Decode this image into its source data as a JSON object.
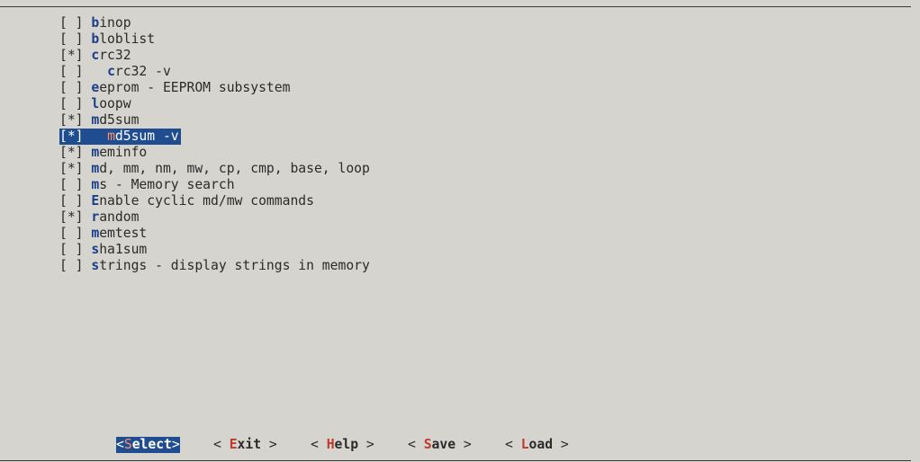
{
  "menu": {
    "items": [
      {
        "checkbox": "[ ]",
        "indent": " ",
        "hotkey": "b",
        "rest": "inop",
        "selected": false
      },
      {
        "checkbox": "[ ]",
        "indent": " ",
        "hotkey": "b",
        "rest": "loblist",
        "selected": false
      },
      {
        "checkbox": "[*]",
        "indent": " ",
        "hotkey": "c",
        "rest": "rc32",
        "selected": false
      },
      {
        "checkbox": "[ ]",
        "indent": "   ",
        "hotkey": "c",
        "rest": "rc32 -v",
        "selected": false
      },
      {
        "checkbox": "[ ]",
        "indent": " ",
        "hotkey": "e",
        "rest": "eprom - EEPROM subsystem",
        "selected": false
      },
      {
        "checkbox": "[ ]",
        "indent": " ",
        "hotkey": "l",
        "rest": "oopw",
        "selected": false
      },
      {
        "checkbox": "[*]",
        "indent": " ",
        "hotkey": "m",
        "rest": "d5sum",
        "selected": false
      },
      {
        "checkbox": "[*]",
        "indent": "   ",
        "hotkey": "m",
        "rest": "d5sum -v",
        "selected": true
      },
      {
        "checkbox": "[*]",
        "indent": " ",
        "hotkey": "m",
        "rest": "eminfo",
        "selected": false
      },
      {
        "checkbox": "[*]",
        "indent": " ",
        "hotkey": "m",
        "rest": "d, mm, nm, mw, cp, cmp, base, loop",
        "selected": false
      },
      {
        "checkbox": "[ ]",
        "indent": " ",
        "hotkey": "m",
        "rest": "s - Memory search",
        "selected": false
      },
      {
        "checkbox": "[ ]",
        "indent": " ",
        "hotkey": "E",
        "rest": "nable cyclic md/mw commands",
        "selected": false
      },
      {
        "checkbox": "[*]",
        "indent": " ",
        "hotkey": "r",
        "rest": "andom",
        "selected": false
      },
      {
        "checkbox": "[ ]",
        "indent": " ",
        "hotkey": "m",
        "rest": "emtest",
        "selected": false
      },
      {
        "checkbox": "[ ]",
        "indent": " ",
        "hotkey": "s",
        "rest": "ha1sum",
        "selected": false
      },
      {
        "checkbox": "[ ]",
        "indent": " ",
        "hotkey": "s",
        "rest": "trings - display strings in memory",
        "selected": false
      }
    ]
  },
  "buttons": [
    {
      "name": "select-button",
      "open": "<",
      "hotkey": "S",
      "rest": "elect",
      "close": ">",
      "active": true
    },
    {
      "name": "exit-button",
      "open": "< ",
      "hotkey": "E",
      "rest": "xit",
      "close": " >",
      "active": false
    },
    {
      "name": "help-button",
      "open": "< ",
      "hotkey": "H",
      "rest": "elp",
      "close": " >",
      "active": false
    },
    {
      "name": "save-button",
      "open": "< ",
      "hotkey": "S",
      "rest": "ave",
      "close": " >",
      "active": false
    },
    {
      "name": "load-button",
      "open": "< ",
      "hotkey": "L",
      "rest": "oad",
      "close": " >",
      "active": false
    }
  ],
  "colors": {
    "background": "#d6d4ce",
    "highlight": "#1f4d8f",
    "menu_hotkey": "#1a3f8a",
    "button_hotkey": "#c0392b"
  }
}
